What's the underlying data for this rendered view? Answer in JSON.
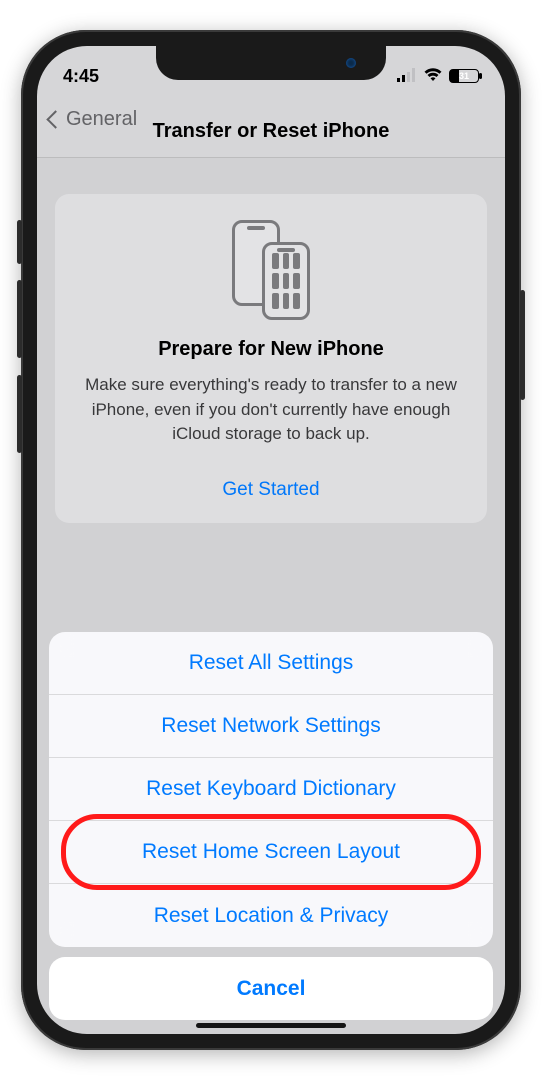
{
  "status": {
    "time": "4:45",
    "battery": "31"
  },
  "nav": {
    "back_label": "General",
    "title": "Transfer or Reset iPhone"
  },
  "prepare": {
    "title": "Prepare for New iPhone",
    "body": "Make sure everything's ready to transfer to a new iPhone, even if you don't currently have enough iCloud storage to back up.",
    "cta": "Get Started"
  },
  "sheet": {
    "items": [
      "Reset All Settings",
      "Reset Network Settings",
      "Reset Keyboard Dictionary",
      "Reset Home Screen Layout",
      "Reset Location & Privacy"
    ],
    "cancel": "Cancel"
  }
}
